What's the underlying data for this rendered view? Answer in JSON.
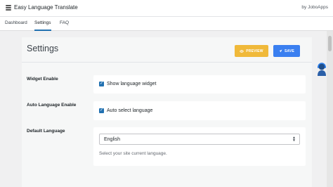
{
  "app": {
    "title": "Easy Language Translate",
    "by": "by JoboApps"
  },
  "tabs": [
    {
      "label": "Dashboard",
      "active": false
    },
    {
      "label": "Settings",
      "active": true
    },
    {
      "label": "FAQ",
      "active": false
    }
  ],
  "page": {
    "title": "Settings",
    "preview_label": "PREVIEW",
    "save_label": "SAVE"
  },
  "settings": {
    "widget_enable": {
      "label": "Widget Enable",
      "checkbox_label": "Show language widget",
      "checked": true
    },
    "auto_language": {
      "label": "Auto Language Enable",
      "checkbox_label": "Auto select language",
      "checked": true
    },
    "default_language": {
      "label": "Default Language",
      "value": "English",
      "help": "Select your site current language."
    }
  },
  "colors": {
    "preview": "#f0b93a",
    "save": "#3a7ff0",
    "checkbox": "#2271b1",
    "active_tab": "#2271b1"
  },
  "icons": {
    "app": "menu-icon",
    "preview": "eye-icon",
    "save": "send-icon",
    "select": "chevron-updown-icon",
    "avatar": "support-agent-icon"
  }
}
